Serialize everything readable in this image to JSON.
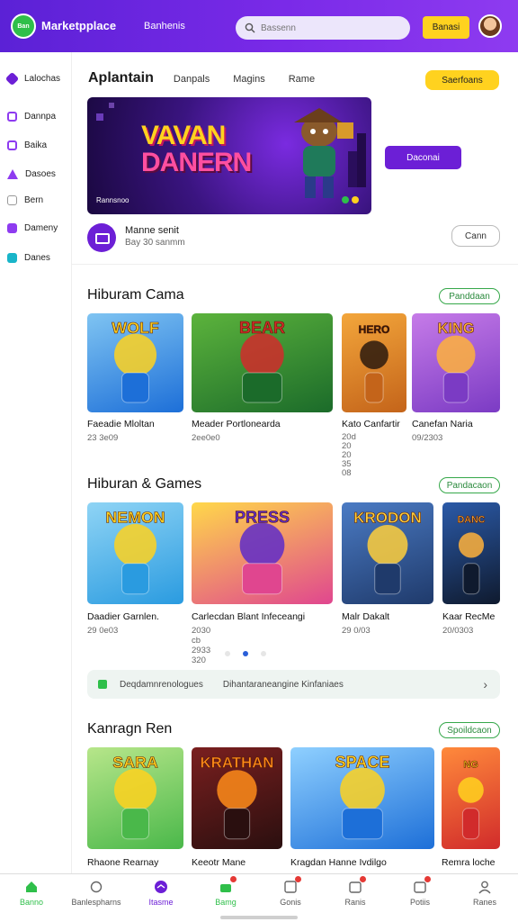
{
  "header": {
    "logo_text": "Ban",
    "brand": "Marketpplace",
    "nav_link": "Banhenis",
    "search_placeholder": "Bassenn",
    "button_label": "Banasi"
  },
  "sidebar": {
    "items": [
      {
        "label": "Lalochas",
        "icon": "tag-icon",
        "color": "#6c1fd6"
      },
      {
        "label": "Dannpa",
        "icon": "grid-icon",
        "color": "#8e3bf0"
      },
      {
        "label": "Baika",
        "icon": "box-icon",
        "color": "#8e3bf0"
      },
      {
        "label": "Dasoes",
        "icon": "triangle-icon",
        "color": "#8e3bf0"
      },
      {
        "label": "Bern",
        "icon": "doc-icon",
        "color": "#999999"
      },
      {
        "label": "Dameny",
        "icon": "dollar-icon",
        "color": "#8e3bf0"
      },
      {
        "label": "Danes",
        "icon": "square-icon",
        "color": "#19b5c9"
      }
    ]
  },
  "main": {
    "tabs": [
      "Aplantain",
      "Danpals",
      "Magins",
      "Rame"
    ],
    "top_button": "Saerfoans",
    "banner": {
      "title_line1": "VAVAN",
      "title_line2": "DANERN",
      "caption": "Rannsnoo",
      "button": "Daconai"
    },
    "publisher": {
      "name": "Manne senit",
      "sub": "Bay 30 sanmm",
      "button": "Cann"
    },
    "sections": [
      {
        "title": "Hiburam Cama",
        "button": "Panddaan",
        "cards": [
          {
            "title": "Faeadie Mloltan",
            "sub": "23 3e09",
            "art": "WOLF",
            "c1": "#1d6fd8",
            "c2": "#7fc4f2",
            "accent": "#ffd21f"
          },
          {
            "title": "Meader Portlonearda",
            "sub": "2ee0e0",
            "art": "BEAR",
            "c1": "#1b6b2a",
            "c2": "#5cb33c",
            "accent": "#d12b2b"
          },
          {
            "title": "Kato Canfartir",
            "sub": "20d 20\n20 35 08",
            "art": "HERO",
            "c1": "#c4641a",
            "c2": "#f3a63b",
            "accent": "#2b1a0e"
          },
          {
            "title": "Canefan Naria",
            "sub": "09/2303",
            "art": "KING",
            "c1": "#7b3bc4",
            "c2": "#c67be8",
            "accent": "#ffb23b"
          }
        ]
      },
      {
        "title": "Hiburan & Games",
        "button": "Pandacaon",
        "cards": [
          {
            "title": "Daadier Garnlen.",
            "sub": "29 0e03",
            "art": "NEMON",
            "c1": "#2a9be0",
            "c2": "#8fd4f5",
            "accent": "#ffd21f"
          },
          {
            "title": "Carlecdan Blant Infeceangi",
            "sub": "2030 cb\n2933 320",
            "art": "PRESS",
            "c1": "#e0468f",
            "c2": "#ffd84a",
            "accent": "#5e2cc9"
          },
          {
            "title": "Malr Dakalt",
            "sub": "29 0/03",
            "art": "KRODON",
            "c1": "#1f3a6b",
            "c2": "#4b7bc4",
            "accent": "#ffcf3b"
          },
          {
            "title": "Kaar RecMe",
            "sub": "20/0303",
            "art": "DANC",
            "c1": "#0f1a2e",
            "c2": "#2b5aa8",
            "accent": "#ffb23b"
          }
        ]
      },
      {
        "title": "Kanragn Ren",
        "button": "Spoildcaon",
        "cards": [
          {
            "title": "Rhaone Rearnay",
            "sub": "",
            "art": "SARA",
            "c1": "#4ab84a",
            "c2": "#b7e68a",
            "accent": "#ffd21f"
          },
          {
            "title": "Keeotr Mane",
            "sub": "",
            "art": "KRATHAN",
            "c1": "#2a0f0f",
            "c2": "#7a1f1f",
            "accent": "#ff8c1a"
          },
          {
            "title": "Kragdan Hanne Ivdilgo",
            "sub": "",
            "art": "SPACE",
            "c1": "#1d6fd8",
            "c2": "#8fd0ff",
            "accent": "#ffd21f"
          },
          {
            "title": "Remra loche",
            "sub": "",
            "art": "NG",
            "c1": "#d12b2b",
            "c2": "#ff8a3b",
            "accent": "#ffd21f"
          }
        ]
      }
    ],
    "promo": {
      "left": "Deqdamnrenologues",
      "right": "Dihantaraneangine Kinfaniaes"
    }
  },
  "bottom_nav": [
    {
      "label": "Banno",
      "icon": "home-icon",
      "active": "green",
      "badge": false
    },
    {
      "label": "Banlespharns",
      "icon": "recycle-icon",
      "active": "",
      "badge": false
    },
    {
      "label": "Itasme",
      "icon": "compass-icon",
      "active": "purple",
      "badge": false
    },
    {
      "label": "Bamg",
      "icon": "store-icon",
      "active": "green",
      "badge": true
    },
    {
      "label": "Gonis",
      "icon": "game-icon",
      "active": "",
      "badge": true
    },
    {
      "label": "Ranis",
      "icon": "gift-icon",
      "active": "",
      "badge": true
    },
    {
      "label": "Potiis",
      "icon": "bell-icon",
      "active": "",
      "badge": true
    },
    {
      "label": "Ranes",
      "icon": "user-icon",
      "active": "",
      "badge": false
    }
  ],
  "colors": {
    "brand_purple": "#6c1fd6",
    "accent_yellow": "#ffd21f",
    "accent_green": "#2fbf4a",
    "pager_active": "#2a5fd8"
  }
}
